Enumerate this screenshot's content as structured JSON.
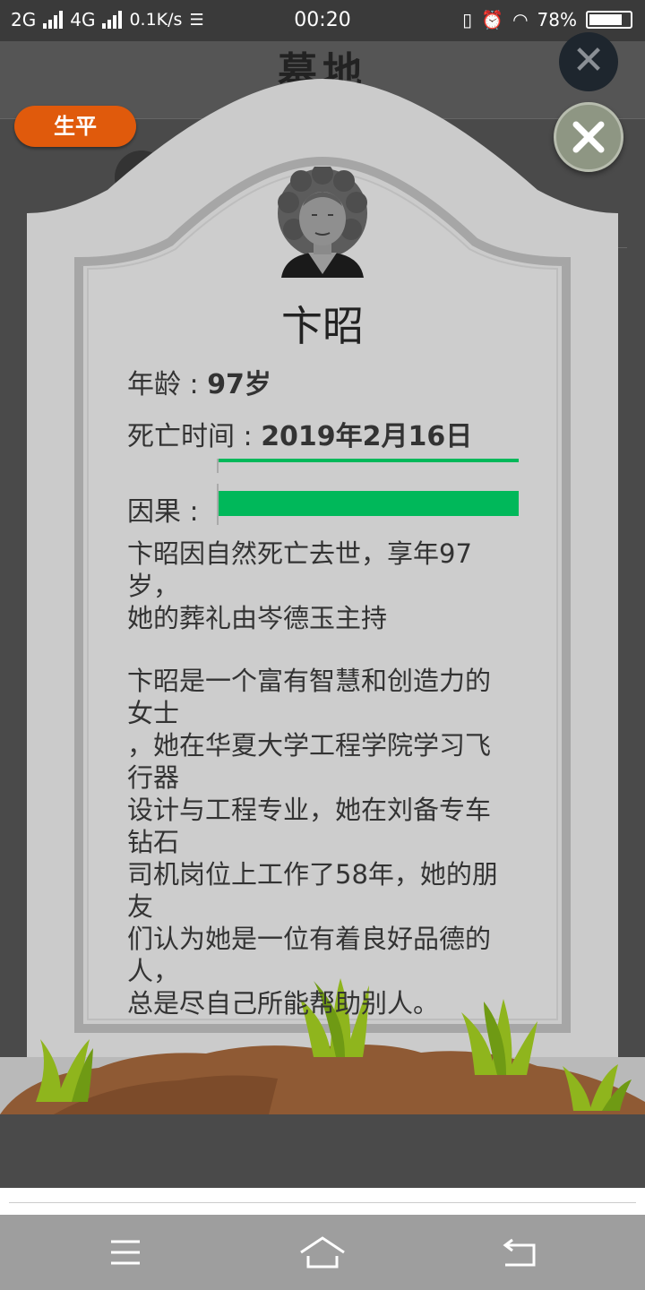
{
  "status_bar": {
    "network_1": "2G",
    "network_2": "4G",
    "speed": "0.1K/s",
    "time": "00:20",
    "battery": "78%"
  },
  "background": {
    "title": "墓地"
  },
  "buttons": {
    "life": "生平"
  },
  "person": {
    "name": "卞昭",
    "age_label": "年龄 : ",
    "age_value": "97岁",
    "death_label": "死亡时间 : ",
    "death_value": "2019年2月16日",
    "karma_label": "因果 : ",
    "karma_level": 1.0,
    "summary_line_1": "卞昭因自然死亡去世，享年97岁，",
    "summary_line_2": "她的葬礼由岑德玉主持",
    "bio_lines": [
      "卞昭是一个富有智慧和创造力的女士",
      "，她在华夏大学工程学院学习飞行器",
      "设计与工程专业，她在刘备专车钻石",
      "司机岗位上工作了58年，她的朋友",
      "们认为她是一位有着良好品德的人，",
      "总是尽自己所能帮助别人。"
    ]
  },
  "colors": {
    "accent_orange": "#e05a0c",
    "karma_green": "#00b85a",
    "stone": "#cbcbcb",
    "soil": "#8f5a34",
    "grass": "#8fb51d"
  }
}
